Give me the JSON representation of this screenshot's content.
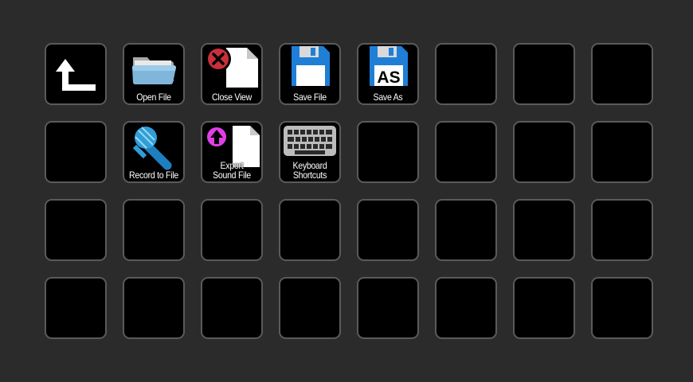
{
  "keys": [
    {
      "id": "back",
      "icon": "back-arrow-icon",
      "label": []
    },
    {
      "id": "open-file",
      "icon": "folder-icon",
      "label": [
        "Open File"
      ]
    },
    {
      "id": "close-view",
      "icon": "close-document-icon",
      "label": [
        "Close View"
      ]
    },
    {
      "id": "save-file",
      "icon": "floppy-disk-icon",
      "label": [
        "Save File"
      ]
    },
    {
      "id": "save-as",
      "icon": "floppy-disk-as-icon",
      "label": [
        "Save As"
      ],
      "badge": "AS"
    },
    {
      "id": "empty-0-5"
    },
    {
      "id": "empty-0-6"
    },
    {
      "id": "empty-0-7"
    },
    {
      "id": "empty-1-0"
    },
    {
      "id": "record-to-file",
      "icon": "microphone-icon",
      "label": [
        "Record to File"
      ]
    },
    {
      "id": "export-sound-file",
      "icon": "export-document-icon",
      "label": [
        "Export",
        "Sound File"
      ]
    },
    {
      "id": "keyboard-shortcuts",
      "icon": "keyboard-icon",
      "label": [
        "Keyboard",
        "Shortcuts"
      ]
    },
    {
      "id": "empty-1-4"
    },
    {
      "id": "empty-1-5"
    },
    {
      "id": "empty-1-6"
    },
    {
      "id": "empty-1-7"
    },
    {
      "id": "empty-2-0"
    },
    {
      "id": "empty-2-1"
    },
    {
      "id": "empty-2-2"
    },
    {
      "id": "empty-2-3"
    },
    {
      "id": "empty-2-4"
    },
    {
      "id": "empty-2-5"
    },
    {
      "id": "empty-2-6"
    },
    {
      "id": "empty-2-7"
    },
    {
      "id": "empty-3-0"
    },
    {
      "id": "empty-3-1"
    },
    {
      "id": "empty-3-2"
    },
    {
      "id": "empty-3-3"
    },
    {
      "id": "empty-3-4"
    },
    {
      "id": "empty-3-5"
    },
    {
      "id": "empty-3-6"
    },
    {
      "id": "empty-3-7"
    }
  ],
  "colors": {
    "background": "#2b2b2b",
    "key_fill": "#000000",
    "key_border": "#5a5a5a",
    "floppy_blue": "#1f7fd6",
    "close_red": "#c8303a",
    "export_magenta": "#e23ee6",
    "mic_blue": "#2f9ed8",
    "folder_blue": "#7fb6da",
    "keyboard_gray": "#bcbcbc"
  }
}
